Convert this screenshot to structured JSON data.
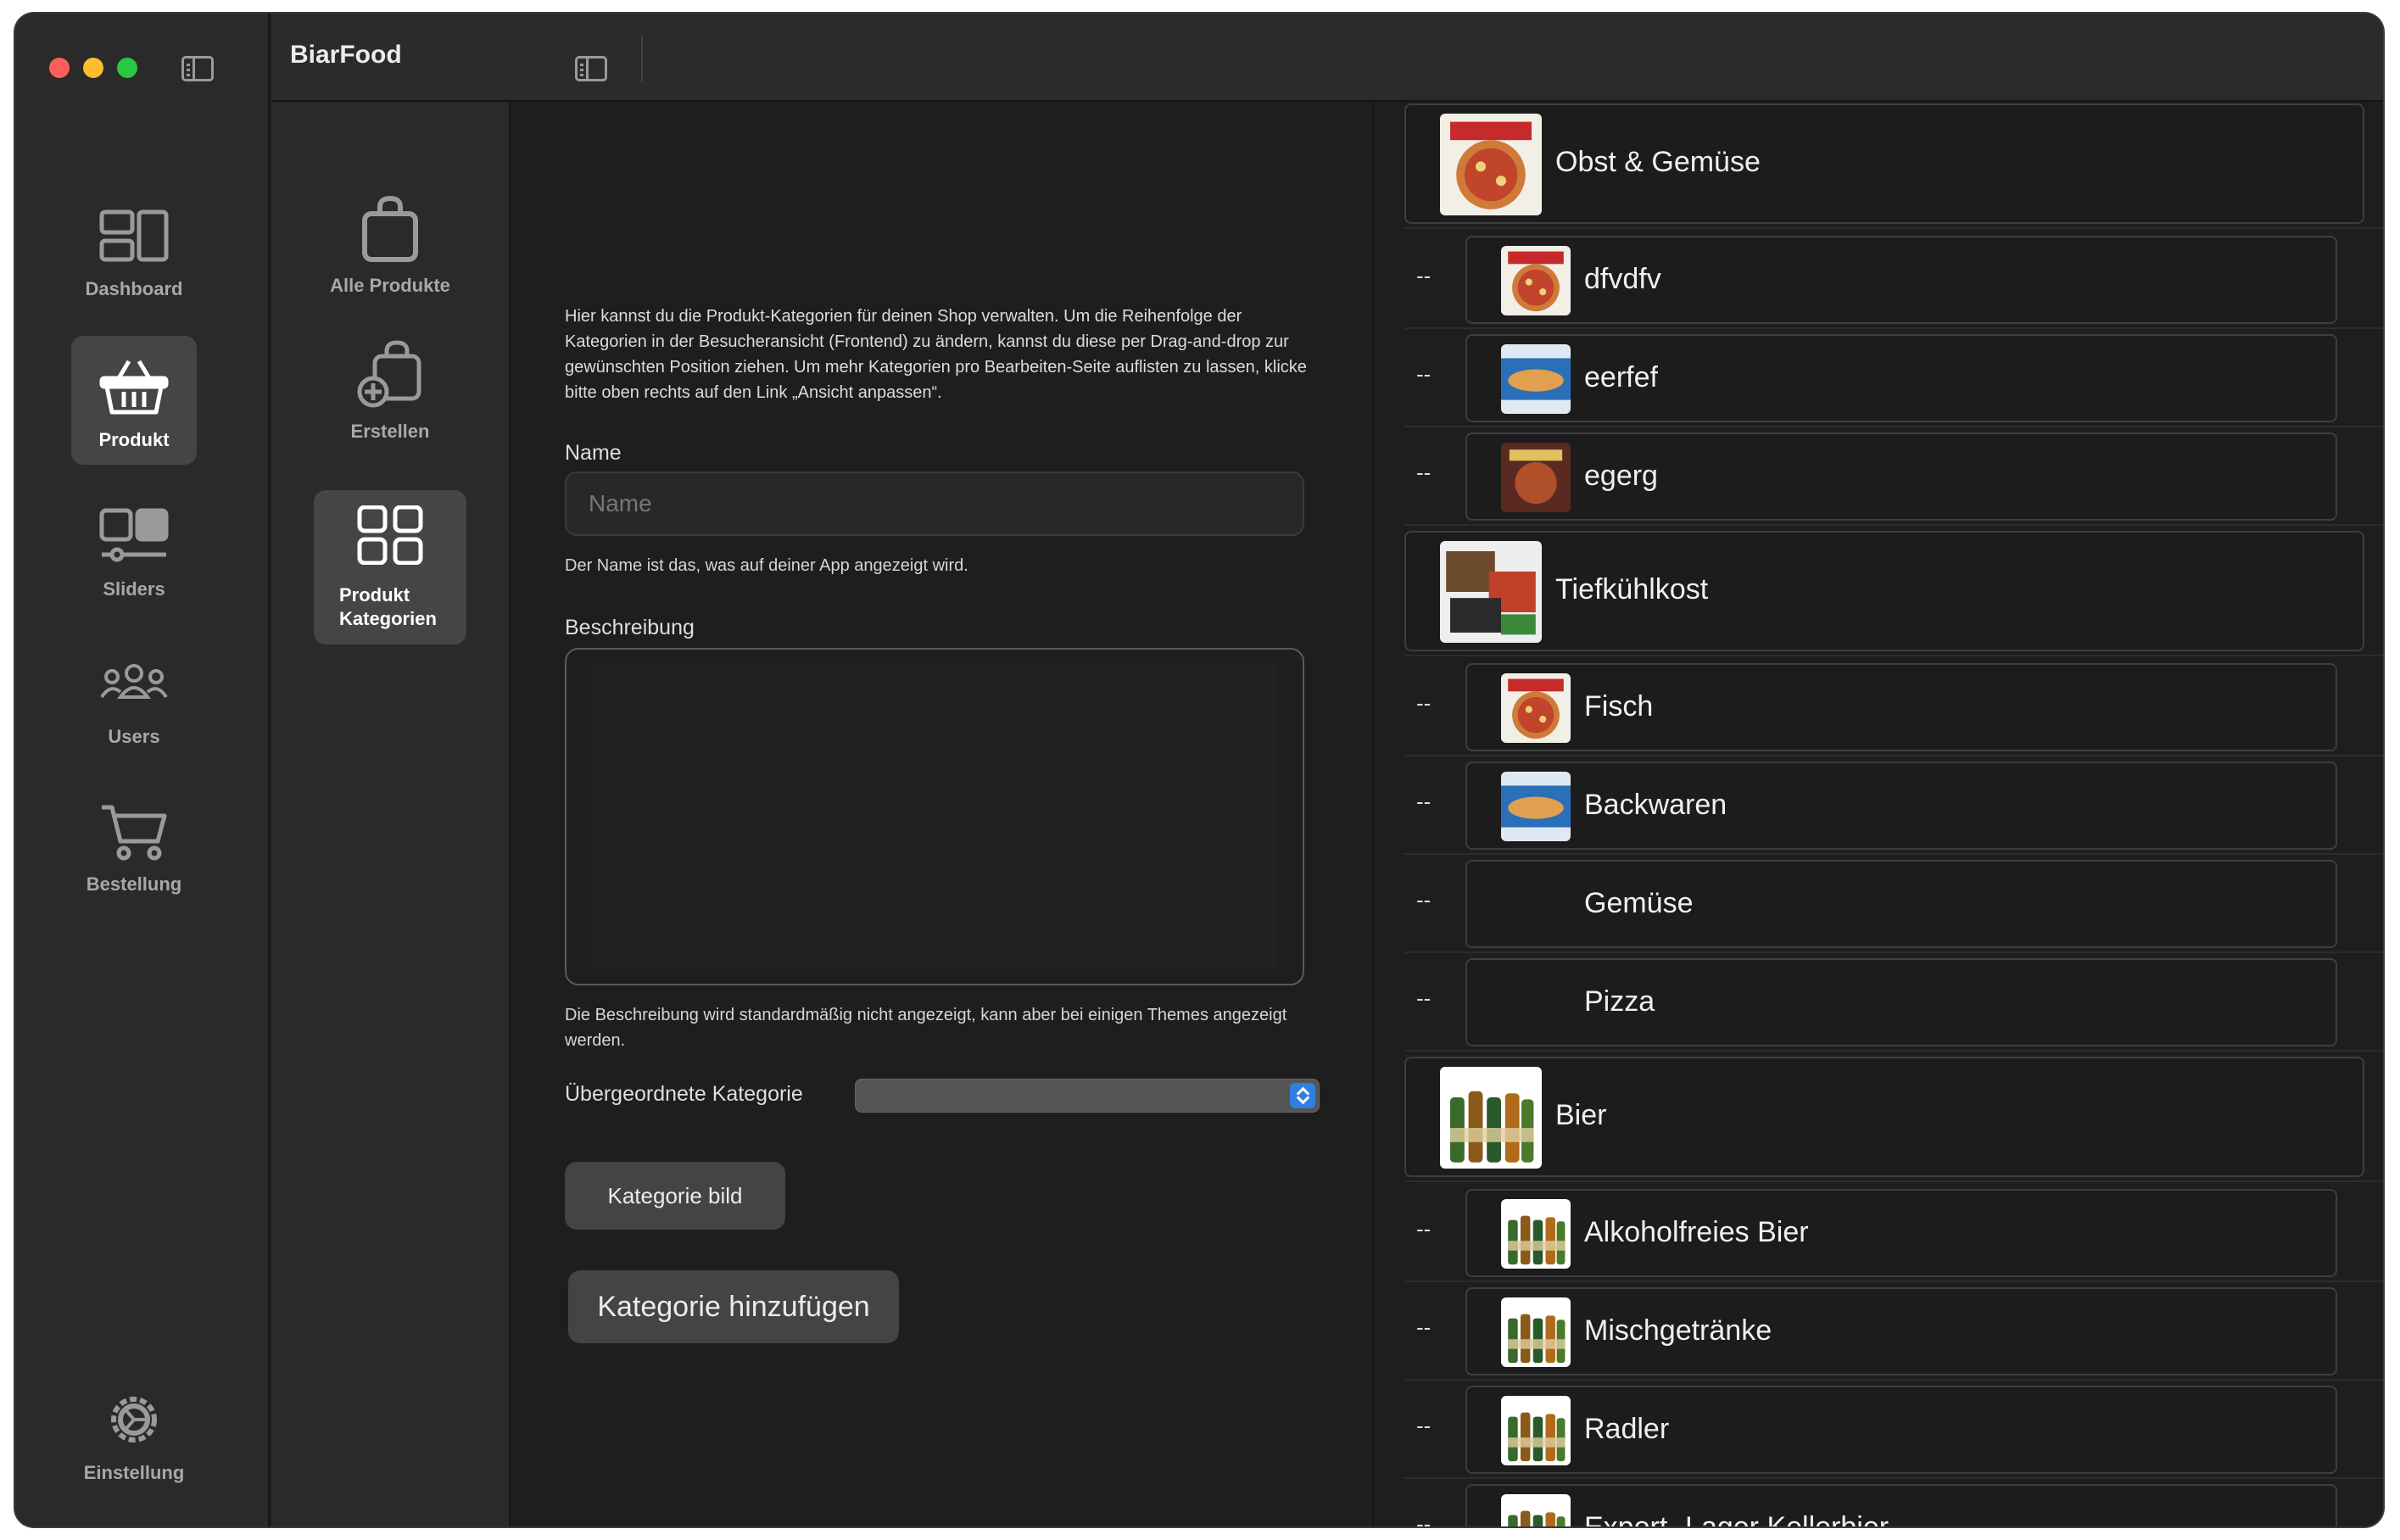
{
  "app": {
    "title": "BiarFood"
  },
  "main_nav": [
    {
      "label": "Dashboard",
      "icon": "dashboard-icon",
      "active": false
    },
    {
      "label": "Produkt",
      "icon": "basket-icon",
      "active": true
    },
    {
      "label": "Sliders",
      "icon": "sliders-icon",
      "active": false
    },
    {
      "label": "Users",
      "icon": "users-icon",
      "active": false
    },
    {
      "label": "Bestellung",
      "icon": "cart-icon",
      "active": false
    },
    {
      "label": "Einstellung",
      "icon": "gear-icon",
      "active": false
    }
  ],
  "sub_nav": [
    {
      "label": "Alle Produkte",
      "icon": "bag-icon",
      "active": false
    },
    {
      "label": "Erstellen",
      "icon": "create-bag-icon",
      "active": false
    },
    {
      "label": "Produkt Kategorien",
      "line1": "Produkt",
      "line2": "Kategorien",
      "icon": "grid-icon",
      "active": true
    }
  ],
  "form": {
    "intro": "Hier kannst du die Produkt-Kategorien für deinen Shop verwalten. Um die Reihenfolge der Kategorien in der Besucheransicht (Frontend) zu ändern, kannst du diese per Drag-and-drop zur gewünschten Position ziehen. Um mehr Kategorien pro Bearbeiten-Seite auflisten zu lassen, klicke bitte oben rechts auf den Link „Ansicht anpassen“.",
    "name_label": "Name",
    "name_placeholder": "Name",
    "name_help": "Der Name ist das, was auf deiner App angezeigt wird.",
    "desc_label": "Beschreibung",
    "desc_help": "Die Beschreibung wird standardmäßig nicht angezeigt, kann aber bei einigen Themes angezeigt werden.",
    "parent_label": "Übergeordnete Kategorie",
    "parent_value": "",
    "image_button": "Kategorie bild",
    "submit_button": "Kategorie hinzufügen"
  },
  "categories": [
    {
      "name": "Obst & Gemüse",
      "level": 0,
      "thumb": "pizza-box",
      "prefix": ""
    },
    {
      "name": "dfvdfv",
      "level": 1,
      "thumb": "pizza-box",
      "prefix": "--"
    },
    {
      "name": "eerfef",
      "level": 1,
      "thumb": "baked-goods",
      "prefix": "--"
    },
    {
      "name": "egerg",
      "level": 1,
      "thumb": "pizza-box-dark",
      "prefix": "--"
    },
    {
      "name": "Tiefkühlkost",
      "level": 0,
      "thumb": "frozen-mix",
      "prefix": ""
    },
    {
      "name": "Fisch",
      "level": 1,
      "thumb": "pizza-box",
      "prefix": "--"
    },
    {
      "name": "Backwaren",
      "level": 1,
      "thumb": "baked-goods",
      "prefix": "--"
    },
    {
      "name": "Gemüse",
      "level": 1,
      "thumb": "",
      "prefix": "--"
    },
    {
      "name": "Pizza",
      "level": 1,
      "thumb": "",
      "prefix": "--"
    },
    {
      "name": "Bier",
      "level": 0,
      "thumb": "bottles",
      "prefix": ""
    },
    {
      "name": "Alkoholfreies Bier",
      "level": 1,
      "thumb": "bottles",
      "prefix": "--"
    },
    {
      "name": "Mischgetränke",
      "level": 1,
      "thumb": "bottles",
      "prefix": "--"
    },
    {
      "name": "Radler",
      "level": 1,
      "thumb": "bottles",
      "prefix": "--"
    },
    {
      "name": "Export- Lager Kellerbier",
      "level": 1,
      "thumb": "bottles",
      "prefix": "--"
    }
  ]
}
